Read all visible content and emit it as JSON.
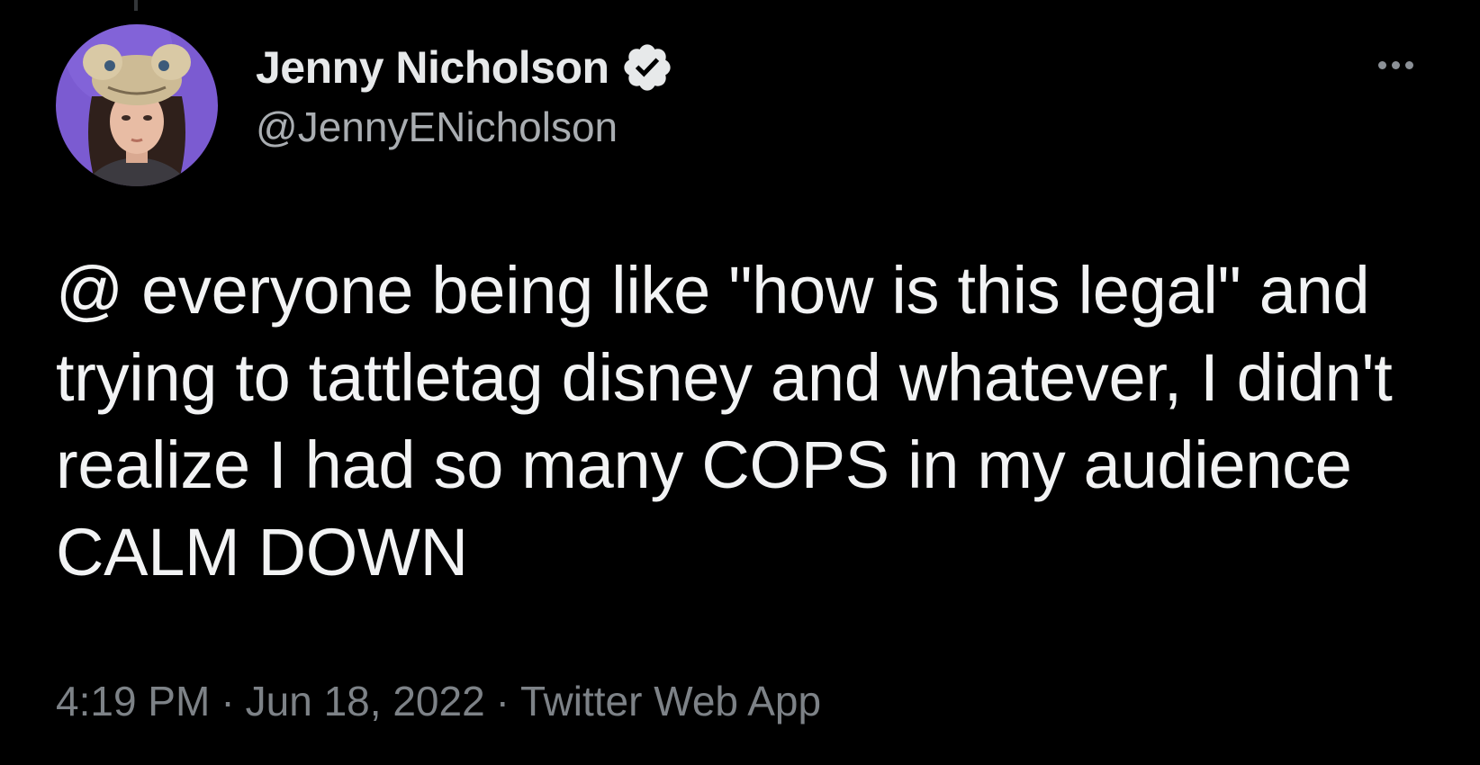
{
  "author": {
    "display_name": "Jenny Nicholson",
    "handle": "@JennyENicholson",
    "verified": true,
    "verified_icon": "verified-badge-icon",
    "avatar_background": "#7b5bd1"
  },
  "tweet": {
    "text": "@ everyone being like \"how is this legal\" and trying to tattletag disney and whatever, I didn't realize I had so many COPS in my audience CALM DOWN"
  },
  "meta": {
    "time": "4:19 PM",
    "separator": "·",
    "date": "Jun 18, 2022",
    "source": "Twitter Web App"
  },
  "actions": {
    "more_icon": "more-horizontal-icon"
  },
  "colors": {
    "background": "#000000",
    "text_primary": "#e7e9ea",
    "text_secondary": "#71767b"
  }
}
